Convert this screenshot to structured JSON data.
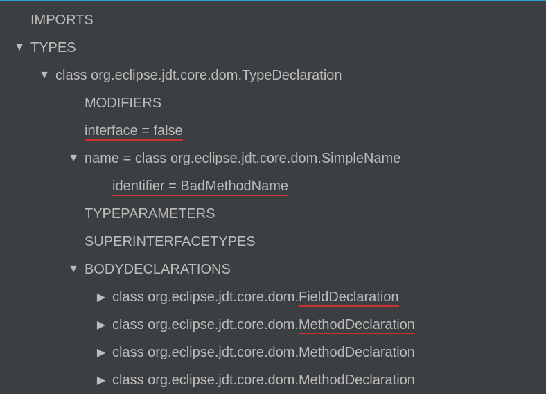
{
  "nodes": {
    "imports": "IMPORTS",
    "types": "TYPES",
    "typeDecl": "class org.eclipse.jdt.core.dom.TypeDeclaration",
    "modifiers": "MODIFIERS",
    "interfaceFalse": "interface = false",
    "nameLine": "name = class org.eclipse.jdt.core.dom.SimpleName",
    "identifier": "identifier = BadMethodName",
    "typeParams": "TYPEPARAMETERS",
    "superInterfaces": "SUPERINTERFACETYPES",
    "bodyDecls": "BODYDECLARATIONS",
    "bodyPrefix": "class org.eclipse.jdt.core.dom.",
    "fieldDecl": "FieldDeclaration",
    "methodDecl": "MethodDeclaration"
  }
}
